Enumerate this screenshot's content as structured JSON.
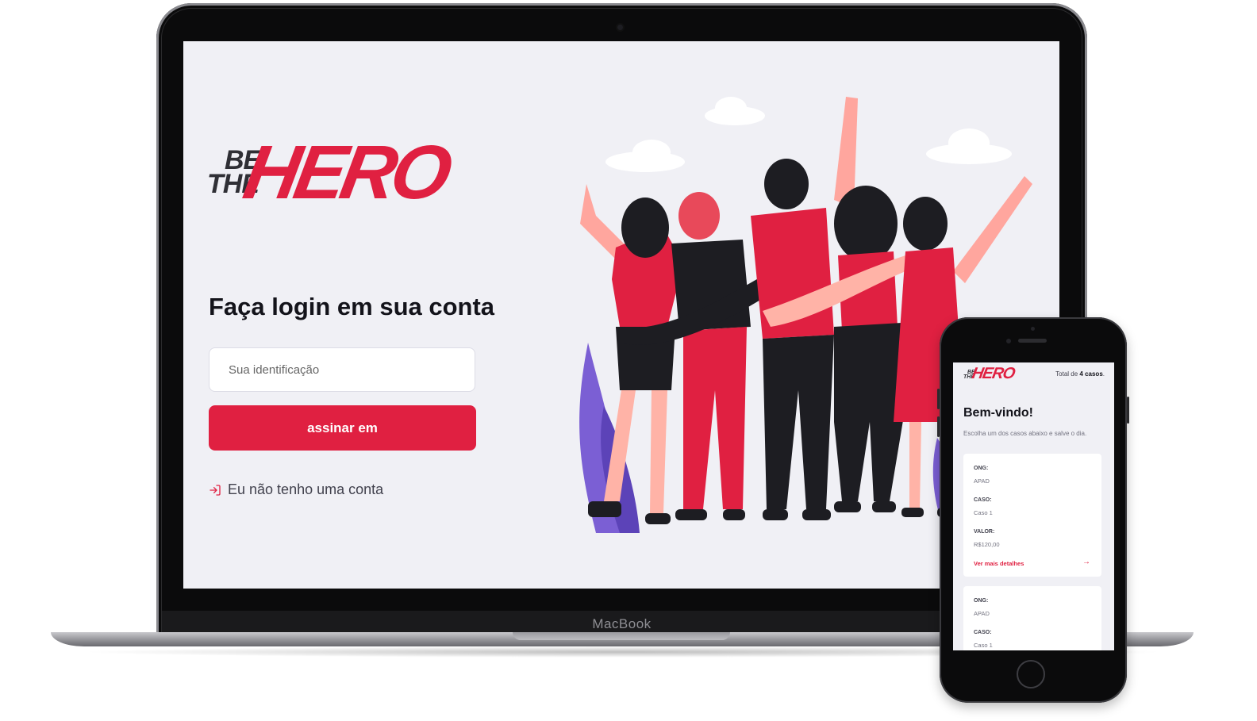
{
  "laptop": {
    "brand": "MacBook",
    "app": {
      "logo": {
        "be": "BE",
        "the": "THE",
        "hero": "HERO"
      },
      "login": {
        "title": "Faça login em sua conta",
        "input_placeholder": "Sua identificação",
        "input_value": "",
        "button_label": "assinar em",
        "register_link": "Eu não tenho uma conta"
      },
      "illustration": "group-of-friends-illustration"
    }
  },
  "phone": {
    "app": {
      "logo": {
        "be": "BE",
        "the": "THE",
        "hero": "HERO"
      },
      "header": {
        "total_prefix": "Total de ",
        "total_count": "4 casos",
        "total_suffix": "."
      },
      "welcome": "Bem-vindo!",
      "subtitle": "Escolha um dos casos abaixo e salve o dia.",
      "cases": [
        {
          "ong_label": "ONG:",
          "ong": "APAD",
          "caso_label": "CASO:",
          "caso": "Caso 1",
          "valor_label": "VALOR:",
          "valor": "R$120,00",
          "details_label": "Ver mais detalhes",
          "details_icon": "arrow-right-icon"
        },
        {
          "ong_label": "ONG:",
          "ong": "APAD",
          "caso_label": "CASO:",
          "caso": "Caso 1"
        }
      ]
    }
  },
  "colors": {
    "brand_red": "#e02041",
    "background": "#f0f0f5",
    "text_dark": "#13131a",
    "logo_dark": "#2f2f35"
  }
}
